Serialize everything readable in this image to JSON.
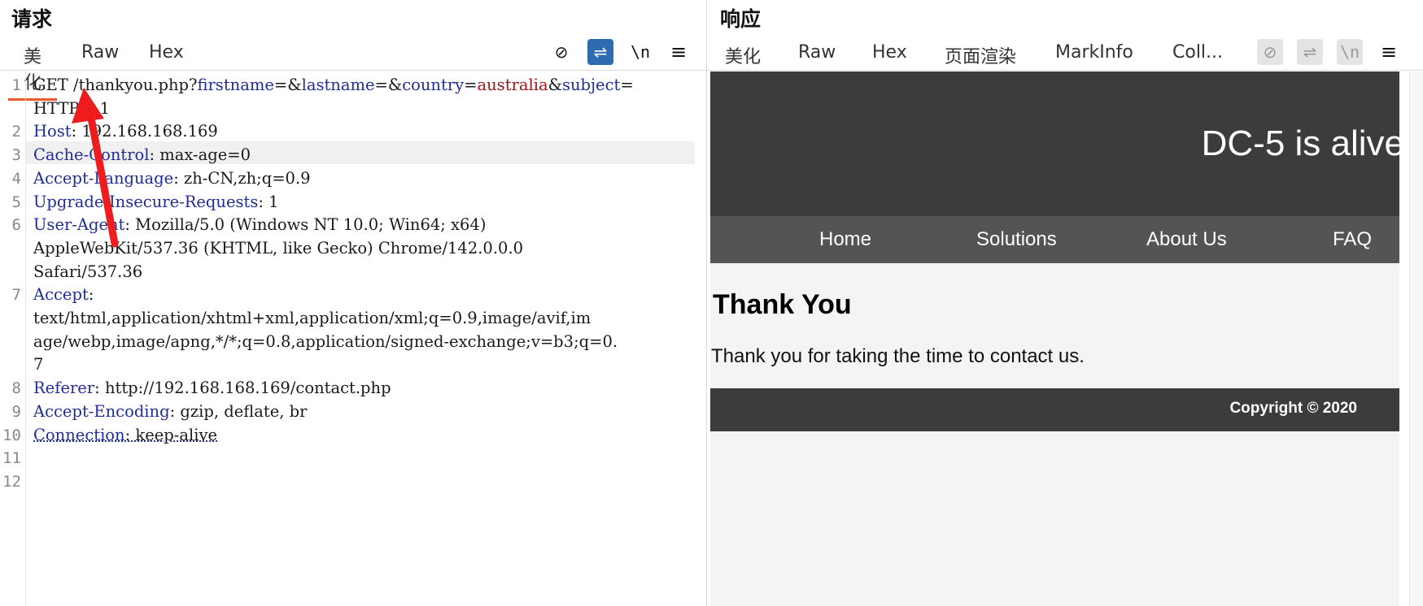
{
  "request": {
    "title": "请求",
    "tabs": [
      "美化",
      "Raw",
      "Hex"
    ],
    "tools": {
      "hide": "⊘",
      "wrap": "⇌",
      "newline": "\\n",
      "menu": "≡"
    },
    "lines": [
      {
        "num": "1",
        "parts": [
          [
            "GET /thankyou.php?",
            ""
          ],
          [
            "firstname",
            "k"
          ],
          [
            "=&",
            ""
          ],
          [
            "lastname",
            "k"
          ],
          [
            "=&",
            ""
          ],
          [
            "country",
            "k"
          ],
          [
            "=",
            ""
          ],
          [
            "australia",
            "v"
          ],
          [
            "&",
            ""
          ],
          [
            "subject",
            "k"
          ],
          [
            "=",
            ""
          ]
        ]
      },
      {
        "num": "",
        "parts": [
          [
            "HTTP/1.1",
            ""
          ]
        ]
      },
      {
        "num": "2",
        "parts": [
          [
            "Host",
            "k"
          ],
          [
            ": 192.168.168.169",
            ""
          ]
        ]
      },
      {
        "num": "3",
        "parts": [
          [
            "Cache-Control",
            "k"
          ],
          [
            ": max-age=0",
            ""
          ]
        ]
      },
      {
        "num": "4",
        "parts": [
          [
            "Accept-Language",
            "k"
          ],
          [
            ": zh-CN,zh;q=0.9",
            ""
          ]
        ]
      },
      {
        "num": "5",
        "parts": [
          [
            "Upgrade-Insecure-Requests",
            "k"
          ],
          [
            ": 1",
            ""
          ]
        ]
      },
      {
        "num": "6",
        "parts": [
          [
            "User-Agent",
            "k"
          ],
          [
            ": Mozilla/5.0 (Windows NT 10.0; Win64; x64)",
            ""
          ]
        ]
      },
      {
        "num": "",
        "parts": [
          [
            "AppleWebKit/537.36 (KHTML, like Gecko) Chrome/142.0.0.0",
            ""
          ]
        ]
      },
      {
        "num": "",
        "parts": [
          [
            "Safari/537.36",
            ""
          ]
        ]
      },
      {
        "num": "7",
        "parts": [
          [
            "Accept",
            "k"
          ],
          [
            ":",
            ""
          ]
        ]
      },
      {
        "num": "",
        "parts": [
          [
            "text/html,application/xhtml+xml,application/xml;q=0.9,image/avif,im",
            ""
          ]
        ]
      },
      {
        "num": "",
        "parts": [
          [
            "age/webp,image/apng,*/*;q=0.8,application/signed-exchange;v=b3;q=0.",
            ""
          ]
        ]
      },
      {
        "num": "",
        "parts": [
          [
            "7",
            ""
          ]
        ]
      },
      {
        "num": "8",
        "parts": [
          [
            "Referer",
            "k"
          ],
          [
            ": http://192.168.168.169/contact.php",
            ""
          ]
        ]
      },
      {
        "num": "9",
        "parts": [
          [
            "Accept-Encoding",
            "k"
          ],
          [
            ": gzip, deflate, br",
            ""
          ]
        ]
      },
      {
        "num": "10",
        "parts": [
          [
            "Connection",
            "kd"
          ],
          [
            ": keep-alive",
            "d"
          ]
        ]
      },
      {
        "num": "11",
        "parts": []
      },
      {
        "num": "12",
        "parts": []
      }
    ]
  },
  "response": {
    "title": "响应",
    "tabs": [
      "美化",
      "Raw",
      "Hex",
      "页面渲染",
      "MarkInfo",
      "Coll..."
    ],
    "tools": {
      "hide": "⊘",
      "wrap": "⇌",
      "newline": "\\n",
      "menu": "≡"
    }
  },
  "rendered_page": {
    "site_title": "DC-5 is alive",
    "nav": [
      "Home",
      "Solutions",
      "About Us",
      "FAQ"
    ],
    "heading": "Thank You",
    "paragraph": "Thank you for taking the time to contact us.",
    "footer": "Copyright © 2020"
  },
  "colors": {
    "accent_tab": "#ea5a2e",
    "header_key": "#1f2d9a",
    "param_value": "#a31515",
    "annotation_arrow": "#ee1c1c"
  }
}
